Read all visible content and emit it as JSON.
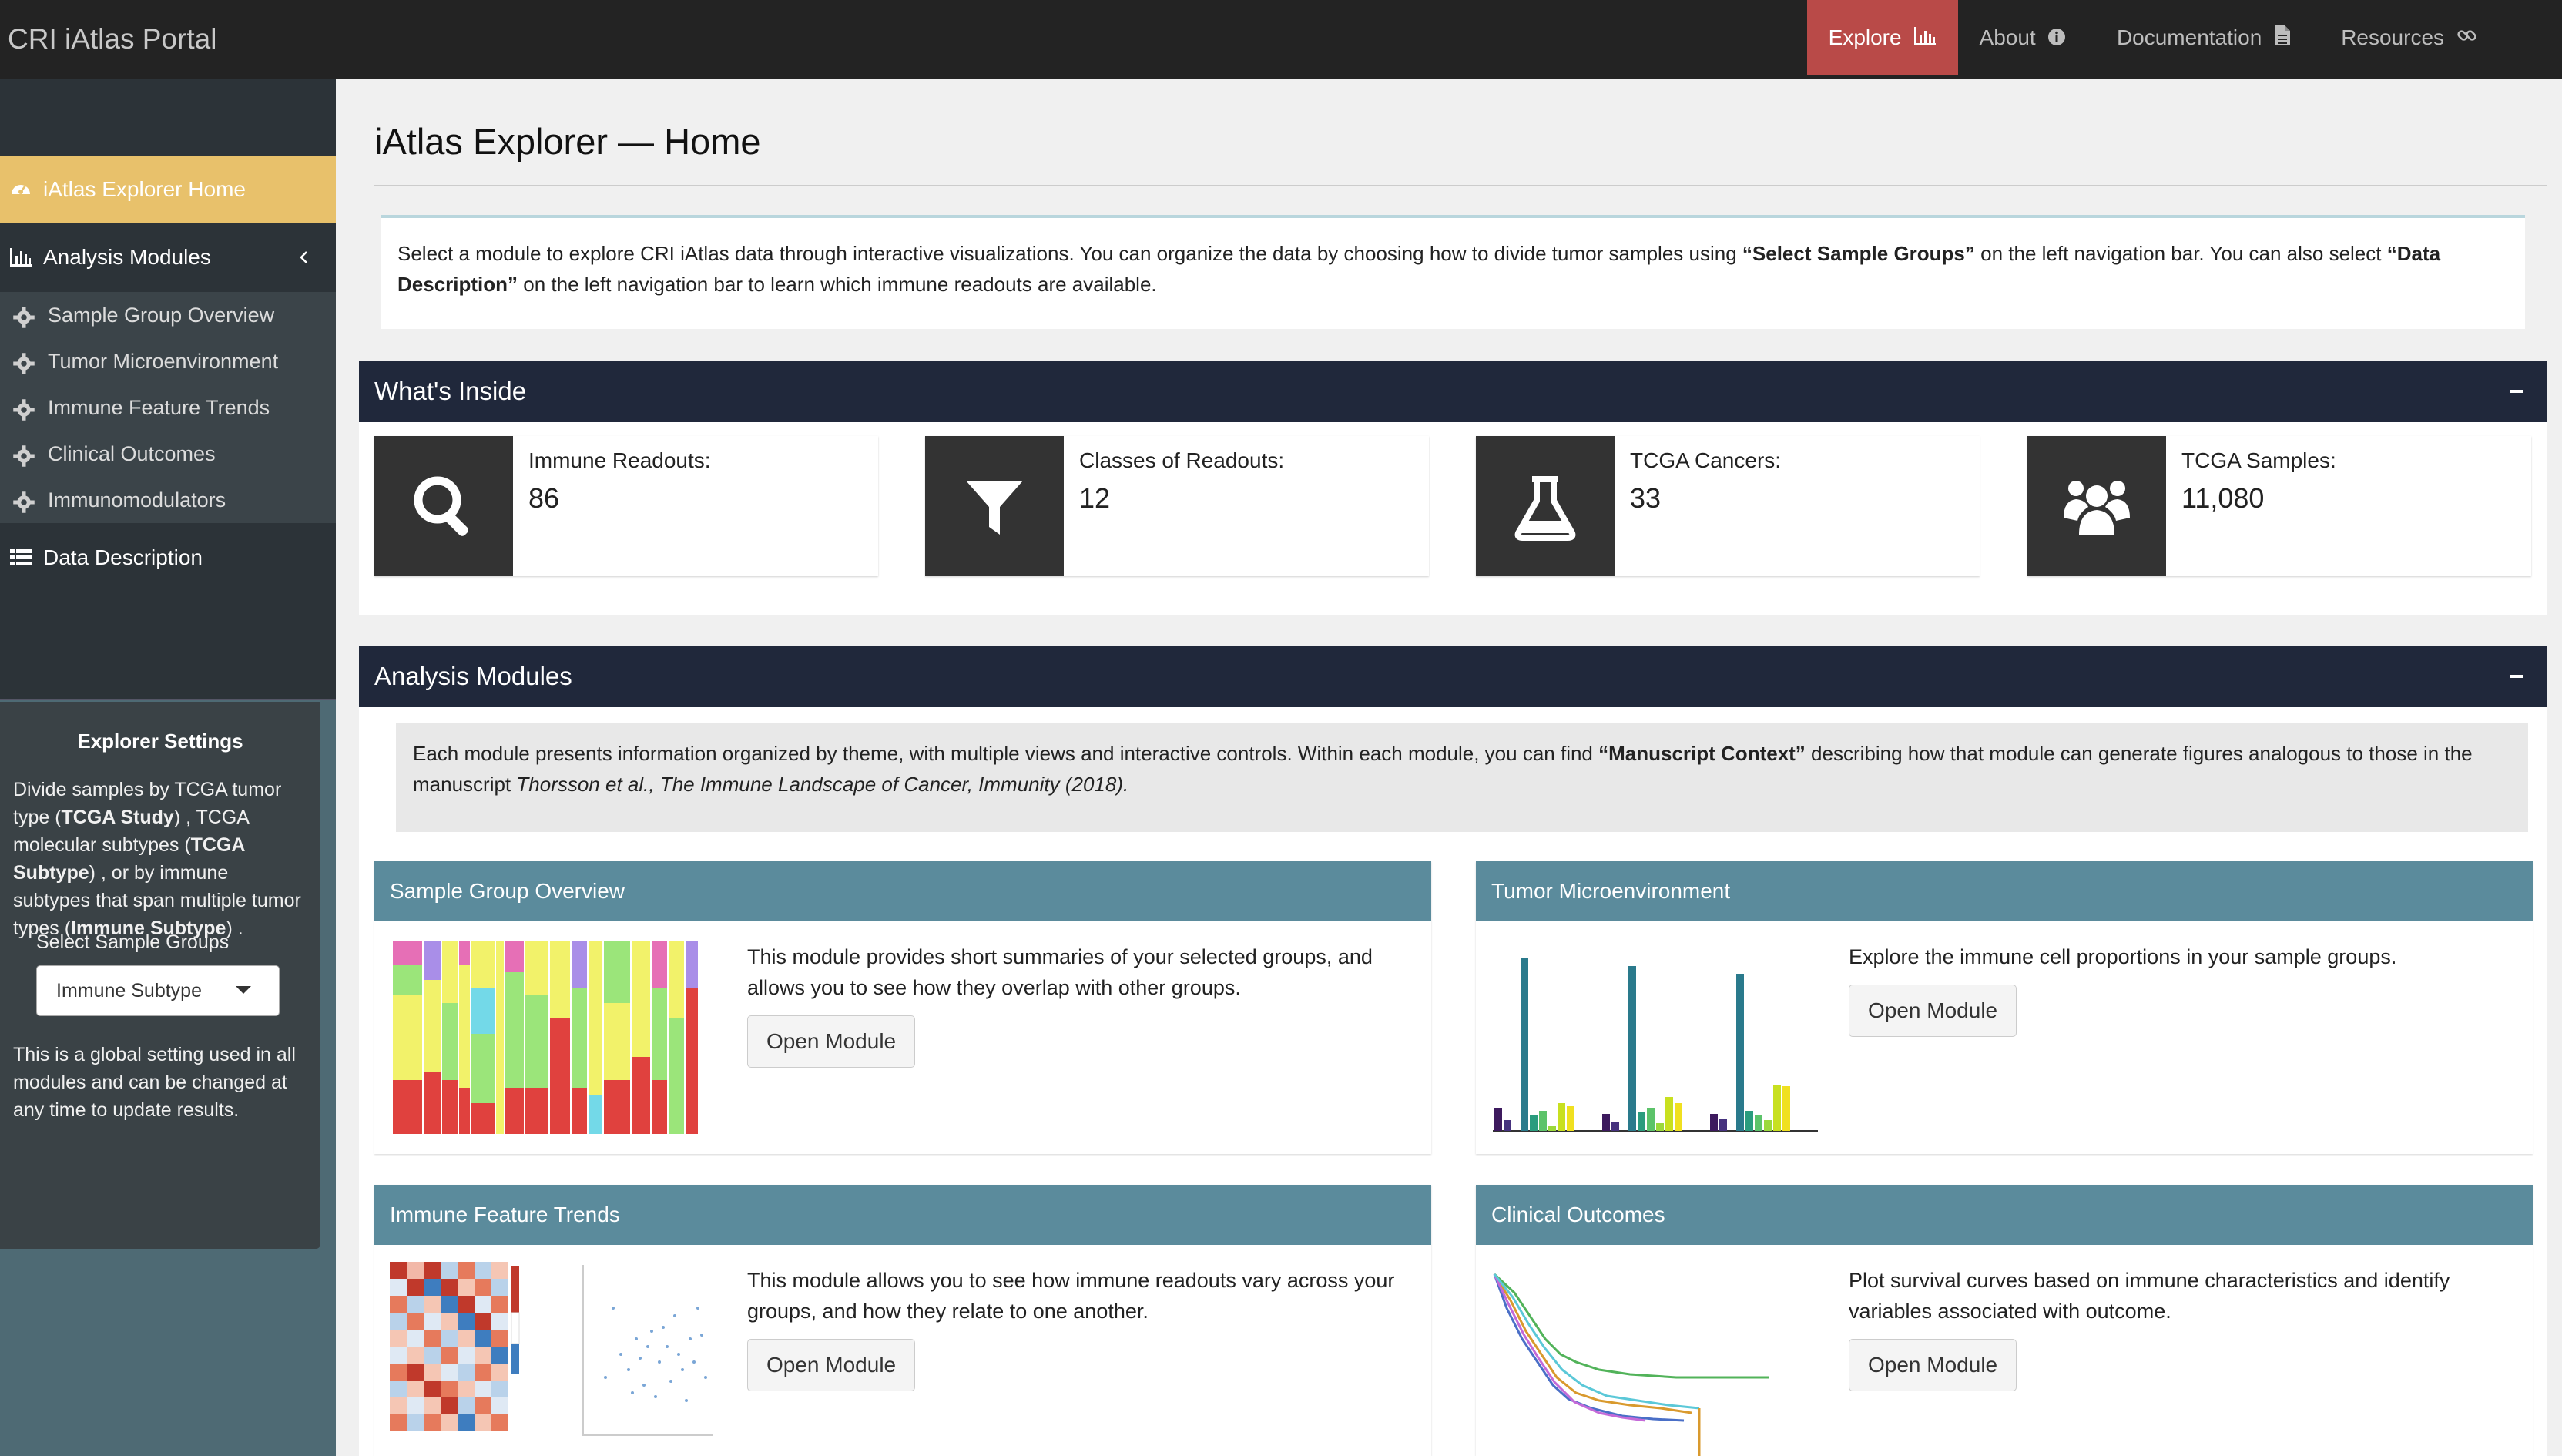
{
  "navbar": {
    "brand": "CRI iAtlas Portal",
    "items": [
      {
        "label": "Explore",
        "icon": "bar-chart-icon",
        "active": true
      },
      {
        "label": "About",
        "icon": "info-icon",
        "active": false
      },
      {
        "label": "Documentation",
        "icon": "document-icon",
        "active": false
      },
      {
        "label": "Resources",
        "icon": "link-icon",
        "active": false
      }
    ]
  },
  "sidebar": {
    "home": "iAtlas Explorer Home",
    "analysis_modules": "Analysis Modules",
    "sub_items": [
      "Sample Group Overview",
      "Tumor Microenvironment",
      "Immune Feature Trends",
      "Clinical Outcomes",
      "Immunomodulators"
    ],
    "data_description": "Data Description",
    "settings": {
      "title": "Explorer Settings",
      "desc_1": "Divide samples by TCGA tumor type (",
      "desc_b1": "TCGA Study",
      "desc_2": ") , TCGA molecular subtypes (",
      "desc_b2": "TCGA Subtype",
      "desc_3": ") , or by immune subtypes that span multiple tumor types (",
      "desc_b3": "Immune Subtype",
      "desc_4": ") .",
      "select_label": "Select Sample Groups",
      "select_value": "Immune Subtype",
      "note": "This is a global setting used in all modules and can be changed at any time to update results."
    }
  },
  "main": {
    "title": "iAtlas Explorer — Home",
    "intro_1": "Select a module to explore CRI iAtlas data through interactive visualizations. You can organize the data by choosing how to divide tumor samples using ",
    "intro_b1": "“Select Sample Groups”",
    "intro_2": " on the left navigation bar. You can also select ",
    "intro_b2": "“Data Description”",
    "intro_3": " on the left navigation bar to learn which immune readouts are available.",
    "whats_inside": {
      "header": "What's Inside",
      "boxes": [
        {
          "label": "Immune Readouts:",
          "value": "86",
          "icon": "search-icon"
        },
        {
          "label": "Classes of Readouts:",
          "value": "12",
          "icon": "filter-icon"
        },
        {
          "label": "TCGA Cancers:",
          "value": "33",
          "icon": "flask-icon"
        },
        {
          "label": "TCGA Samples:",
          "value": "11,080",
          "icon": "users-icon"
        }
      ]
    },
    "analysis_modules": {
      "header": "Analysis Modules",
      "note_1": "Each module presents information organized by theme, with multiple views and interactive controls. Within each module, you can find ",
      "note_b": "“Manuscript Context”",
      "note_2": " describing how that module can generate figures analogous to those in the manuscript ",
      "note_i": "Thorsson et al., The Immune Landscape of Cancer, Immunity (2018).",
      "modules": [
        {
          "title": "Sample Group Overview",
          "desc": "This module provides short summaries of your selected groups, and allows you to see how they overlap with other groups.",
          "button": "Open Module"
        },
        {
          "title": "Tumor Microenvironment",
          "desc": "Explore the immune cell proportions in your sample groups.",
          "button": "Open Module"
        },
        {
          "title": "Immune Feature Trends",
          "desc": "This module allows you to see how immune readouts vary across your groups, and how they relate to one another.",
          "button": "Open Module"
        },
        {
          "title": "Clinical Outcomes",
          "desc": "Plot survival curves based on immune characteristics and identify variables associated with outcome.",
          "button": "Open Module"
        }
      ]
    }
  },
  "colors": {
    "navbar_bg": "#232323",
    "explore_active": "#b94a48",
    "home_highlight": "#e8c16b",
    "box_header": "#20283b",
    "module_header": "#5b8b9c",
    "infobox_icon_bg": "#333333"
  }
}
